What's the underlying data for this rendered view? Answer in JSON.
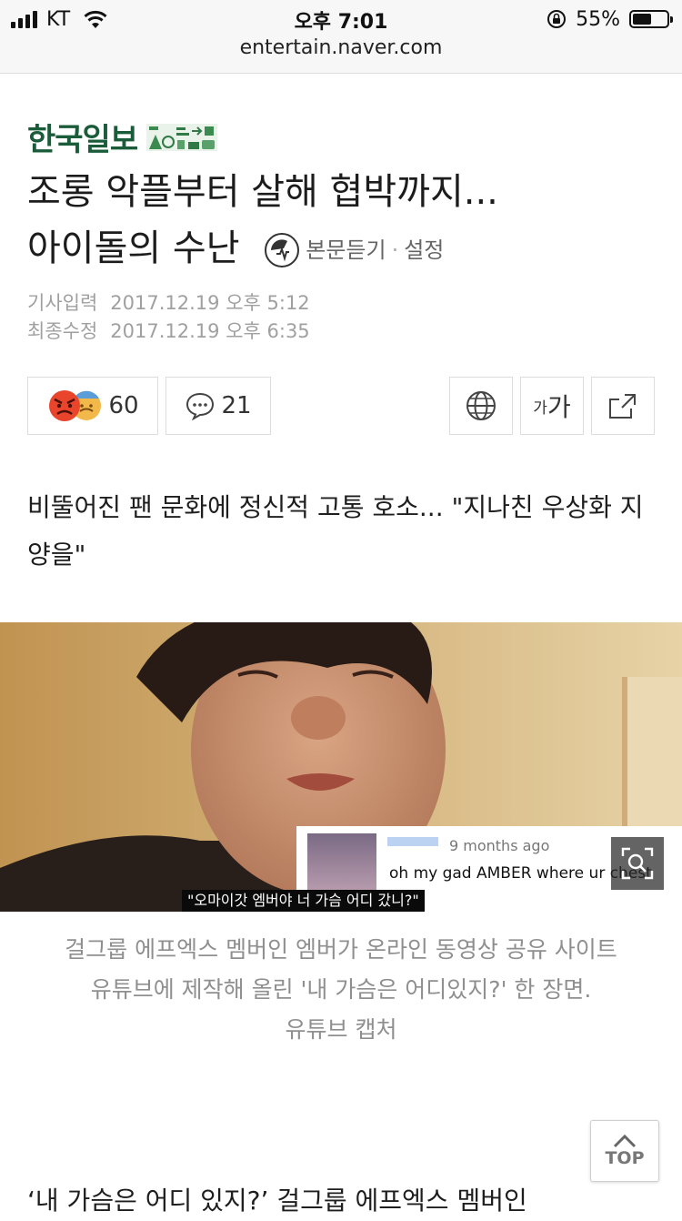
{
  "status_bar": {
    "carrier": "KT",
    "time": "오후 7:01",
    "battery_percent": "55%",
    "battery_level": 0.55,
    "url": "entertain.naver.com"
  },
  "article": {
    "press_name": "한국일보",
    "headline_line1": "조롱 악플부터 살해 협박까지...",
    "headline_line2": "아이돌의 수난",
    "tts_label": "본문듣기",
    "tts_separator": "·",
    "tts_settings": "설정",
    "published_label": "기사입력",
    "published_date": "2017.12.19 오후 5:12",
    "modified_label": "최종수정",
    "modified_date": "2017.12.19 오후 6:35",
    "reaction_count": "60",
    "comment_count": "21",
    "font_size_small": "가",
    "font_size_big": "가",
    "subheadline": "비뚤어진 팬 문화에 정신적 고통 호소... \"지나친 우상화 지양을\"",
    "photo": {
      "subtitle": "\"오마이갓 엠버야 너 가슴 어디 갔니?\"",
      "comment_time": "9 months ago",
      "comment_text": "oh my gad AMBER where ur chest"
    },
    "caption_line1": "걸그룹 에프엑스 멤버인 엠버가 온라인 동영상 공유 사이트",
    "caption_line2": "유튜브에 제작해 올린 '내 가슴은 어디있지?' 한 장면.",
    "caption_line3": "유튜브 캡처",
    "next_paragraph": "‘내 가슴은 어디 있지?’ 걸그룹 에프엑스 멤버인"
  },
  "top_button": "TOP",
  "colors": {
    "press_green": "#1a5c3a",
    "status_bg": "#f7f7f7",
    "caption_gray": "#8f8f8f",
    "border": "#dddddd"
  },
  "icons": [
    "signal-icon",
    "wifi-icon",
    "lock-rotation-icon",
    "battery-icon",
    "tts-icon",
    "angry-face-icon",
    "sad-face-icon",
    "comment-icon",
    "globe-icon",
    "share-icon",
    "zoom-icon",
    "chevron-up-icon"
  ]
}
